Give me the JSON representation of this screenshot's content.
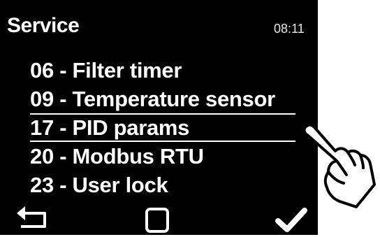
{
  "header": {
    "title": "Service",
    "time": "08:11"
  },
  "menu": {
    "items": [
      {
        "label": "06 - Filter timer",
        "selected": false
      },
      {
        "label": "09 - Temperature sensor",
        "selected": false
      },
      {
        "label": "17 - PID params",
        "selected": true
      },
      {
        "label": "20 - Modbus RTU",
        "selected": false
      },
      {
        "label": "23 - User lock",
        "selected": false
      }
    ]
  },
  "softkeys": {
    "left": "back-arrow-icon",
    "center": "square-icon",
    "right": "checkmark-icon"
  },
  "colors": {
    "screen_background": "#000000",
    "text": "#ffffff",
    "page_background": "#ffffff"
  }
}
